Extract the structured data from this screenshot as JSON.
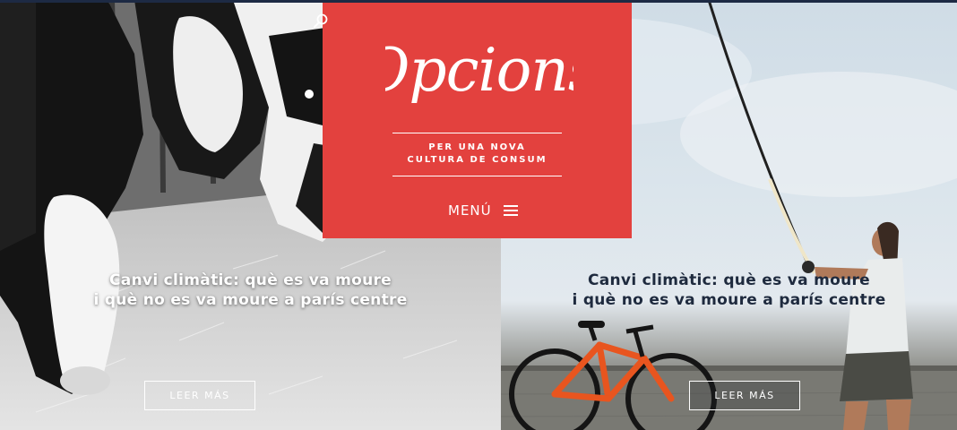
{
  "header": {
    "logo_text": "Opcions",
    "tagline_line1": "PER UNA NOVA",
    "tagline_line2": "CULTURA DE CONSUM",
    "menu_label": "MENÚ"
  },
  "icons": {
    "search": "search-icon",
    "menu": "hamburger-icon"
  },
  "articles": [
    {
      "title_line1": "Canvi climàtic: què es va moure",
      "title_line2": "i què no es va moure a parís centre",
      "button_label": "LEER MÁS",
      "image": "black-and-white photo of cows eating hay"
    },
    {
      "title_line1": "Canvi climàtic: què es va moure",
      "title_line2": "i què no es va moure a parís centre",
      "button_label": "LEER MÁS",
      "image": "man fishing with a rod next to an orange bicycle"
    }
  ],
  "colors": {
    "brand_red": "#e3413e",
    "navy": "#1d2a44",
    "white": "#ffffff"
  }
}
